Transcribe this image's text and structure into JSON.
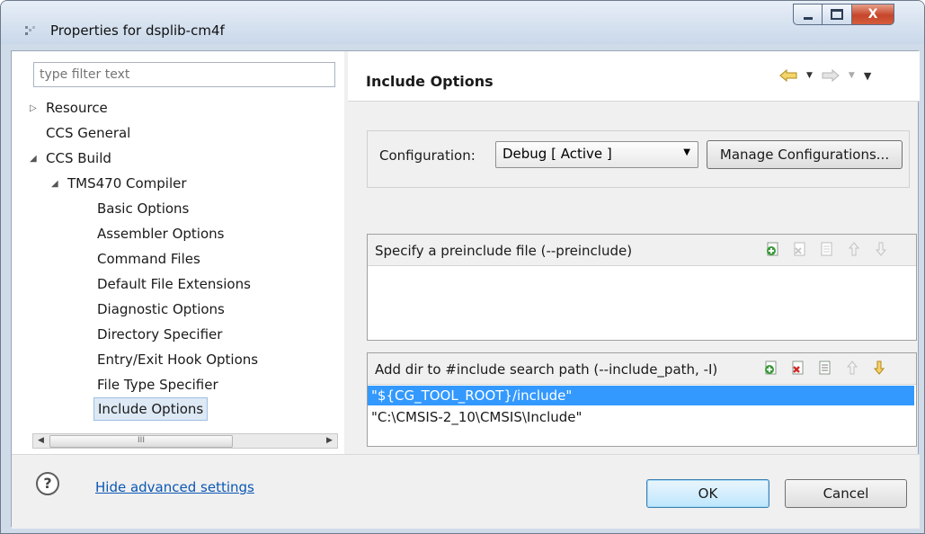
{
  "window": {
    "title": "Properties for dsplib-cm4f",
    "controls": {
      "minimize_icon": "minimize-icon",
      "maximize_icon": "maximize-icon",
      "close_glyph": "X"
    }
  },
  "filter": {
    "placeholder": "type filter text"
  },
  "tree": [
    {
      "label": "Resource",
      "toggle": "collapsed"
    },
    {
      "label": "CCS General"
    },
    {
      "label": "CCS Build",
      "toggle": "expanded"
    },
    {
      "label": "TMS470 Compiler",
      "toggle": "expanded"
    },
    {
      "label": "Basic Options"
    },
    {
      "label": "Assembler Options"
    },
    {
      "label": "Command Files"
    },
    {
      "label": "Default File Extensions"
    },
    {
      "label": "Diagnostic Options"
    },
    {
      "label": "Directory Specifier"
    },
    {
      "label": "Entry/Exit Hook Options"
    },
    {
      "label": "File Type Specifier"
    },
    {
      "label": "Include Options",
      "selected": true
    }
  ],
  "hscroll": {
    "grip": "III"
  },
  "page": {
    "title": "Include Options"
  },
  "configuration": {
    "label": "Configuration:",
    "selected": "Debug  [ Active ]",
    "manage_button": "Manage Configurations..."
  },
  "preinclude": {
    "title": "Specify a preinclude file (--preinclude)",
    "items": []
  },
  "include_path": {
    "title": "Add dir to #include search path (--include_path, -I)",
    "items": [
      {
        "value": "\"${CG_TOOL_ROOT}/include\"",
        "selected": true
      },
      {
        "value": "\"C:\\CMSIS-2_10\\CMSIS\\Include\""
      }
    ]
  },
  "footer": {
    "help_glyph": "?",
    "advanced_link": "Hide advanced settings",
    "ok": "OK",
    "cancel": "Cancel"
  },
  "colors": {
    "selection": "#3399ff",
    "link": "#0b57b4",
    "close_button": "#c6452a"
  }
}
